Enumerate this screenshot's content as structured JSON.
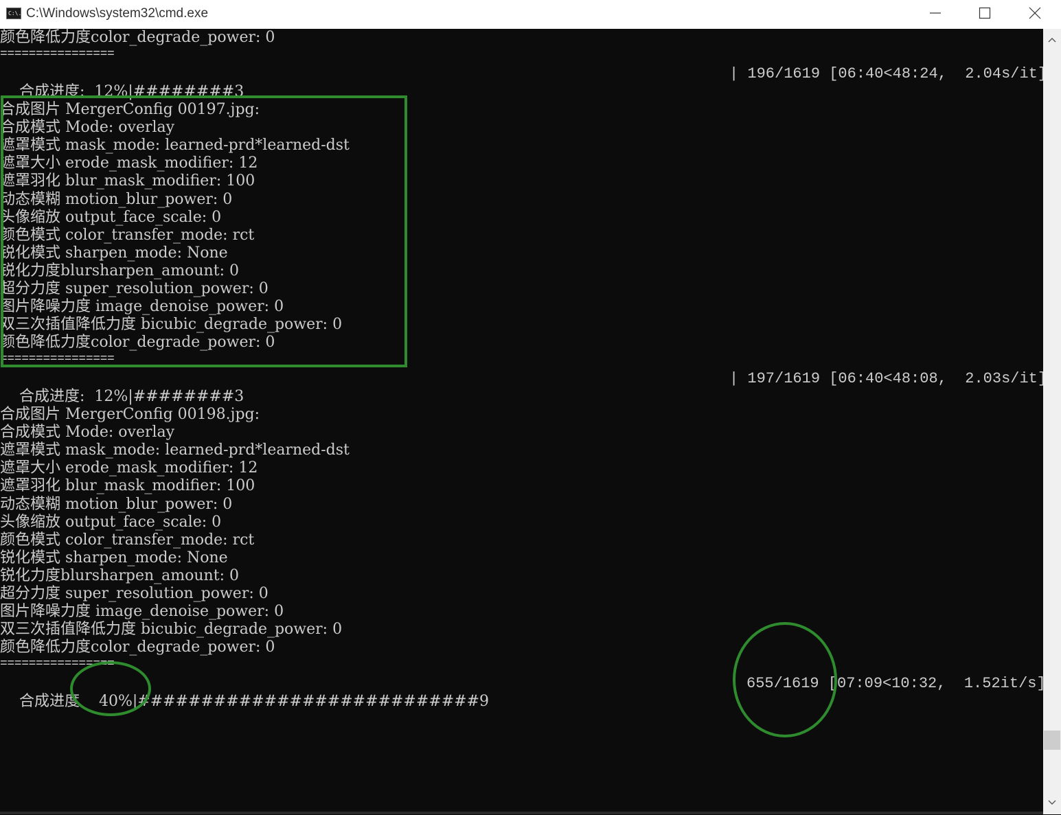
{
  "window": {
    "title": "C:\\Windows\\system32\\cmd.exe",
    "icon": "cmd-icon",
    "icon_text": "C:\\."
  },
  "console": {
    "top_line": "颜色降低力度color_degrade_power: 0",
    "separator": "================",
    "progress": [
      {
        "label": "合成进度:",
        "percent": "12%",
        "bar": "|########3",
        "stats": "| 196/1619 [06:40<48:24,  2.04s/it]"
      },
      {
        "label": "合成进度:",
        "percent": "12%",
        "bar": "|########3",
        "stats": "| 197/1619 [06:40<48:08,  2.03s/it]"
      },
      {
        "label": "合成进度",
        "percent": "40%",
        "bar": "|###########################9",
        "stats": "655/1619 [07:09<10:32,  1.52it/s]"
      }
    ],
    "blocks": [
      {
        "lines": [
          "合成图片 MergerConfig 00197.jpg:",
          "合成模式 Mode: overlay",
          "遮罩模式 mask_mode: learned-prd*learned-dst",
          "遮罩大小 erode_mask_modifier: 12",
          "遮罩羽化 blur_mask_modifier: 100",
          "动态模糊 motion_blur_power: 0",
          "头像缩放 output_face_scale: 0",
          "颜色模式 color_transfer_mode: rct",
          "锐化模式 sharpen_mode: None",
          "锐化力度blursharpen_amount: 0",
          "超分力度 super_resolution_power: 0",
          "图片降噪力度 image_denoise_power: 0",
          "双三次插值降低力度 bicubic_degrade_power: 0",
          "颜色降低力度color_degrade_power: 0"
        ]
      },
      {
        "lines": [
          "合成图片 MergerConfig 00198.jpg:",
          "合成模式 Mode: overlay",
          "遮罩模式 mask_mode: learned-prd*learned-dst",
          "遮罩大小 erode_mask_modifier: 12",
          "遮罩羽化 blur_mask_modifier: 100",
          "动态模糊 motion_blur_power: 0",
          "头像缩放 output_face_scale: 0",
          "颜色模式 color_transfer_mode: rct",
          "锐化模式 sharpen_mode: None",
          "锐化力度blursharpen_amount: 0",
          "超分力度 super_resolution_power: 0",
          "图片降噪力度 image_denoise_power: 0",
          "双三次插值降低力度 bicubic_degrade_power: 0",
          "颜色降低力度color_degrade_power: 0"
        ]
      }
    ]
  },
  "colors": {
    "console_bg": "#0c0c0c",
    "console_text": "#cccccc",
    "annotation": "#2e8b2e"
  }
}
